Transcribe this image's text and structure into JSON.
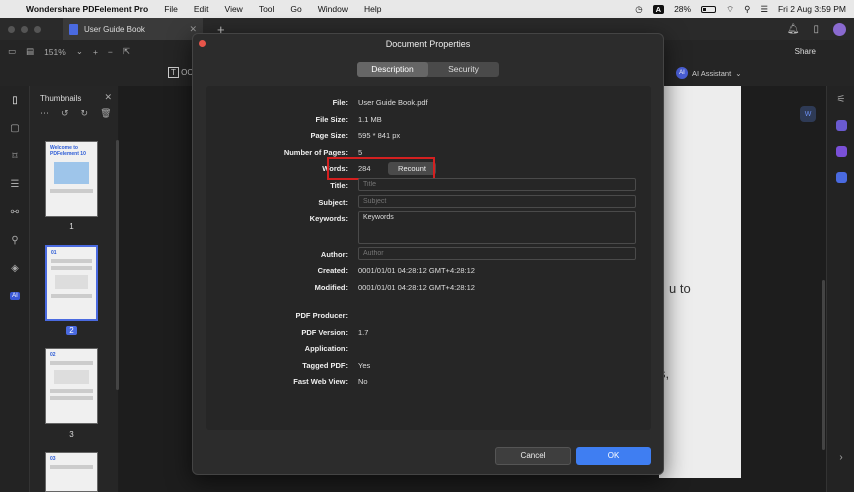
{
  "menubar": {
    "app_name": "Wondershare PDFelement Pro",
    "items": [
      "File",
      "Edit",
      "View",
      "Tool",
      "Go",
      "Window",
      "Help"
    ],
    "input_source": "A",
    "battery": "28%",
    "clock": "Fri 2 Aug  3:59 PM"
  },
  "tabbar": {
    "tab_title": "User Guide Book",
    "close_glyph": "✕",
    "new_tab_glyph": "+"
  },
  "toolbar": {
    "zoom": "151%",
    "share_label": "Share",
    "text_tool_label": "OC",
    "ai_badge": "AI",
    "ai_label": "AI Assistant"
  },
  "left_rail": {
    "ai_tag": "AI"
  },
  "thumbnails": {
    "title": "Thumbnails",
    "pages": [
      {
        "num": "1",
        "heading": "Welcome to PDFelement 10"
      },
      {
        "num": "2",
        "heading": "01"
      },
      {
        "num": "3",
        "heading": "02"
      },
      {
        "num": "",
        "heading": "03"
      }
    ]
  },
  "document": {
    "visible_text_1": "u to",
    "visible_text_2": "s,"
  },
  "dialog": {
    "title": "Document Properties",
    "tabs": {
      "description": "Description",
      "security": "Security"
    },
    "fields": {
      "file_label": "File:",
      "file_value": "User Guide Book.pdf",
      "filesize_label": "File Size:",
      "filesize_value": "1.1 MB",
      "pagesize_label": "Page Size:",
      "pagesize_value": "595 * 841 px",
      "pages_label": "Number of Pages:",
      "pages_value": "5",
      "words_label": "Words:",
      "words_value": "284",
      "recount_label": "Recount",
      "title_label": "Title:",
      "title_placeholder": "Title",
      "subject_label": "Subject:",
      "subject_placeholder": "Subject",
      "keywords_label": "Keywords:",
      "keywords_value": "Keywords",
      "author_label": "Author:",
      "author_placeholder": "Author",
      "created_label": "Created:",
      "created_value": "0001/01/01 04:28:12 GMT+4:28:12",
      "modified_label": "Modified:",
      "modified_value": "0001/01/01 04:28:12 GMT+4:28:12",
      "producer_label": "PDF Producer:",
      "producer_value": "",
      "version_label": "PDF Version:",
      "version_value": "1.7",
      "application_label": "Application:",
      "application_value": "",
      "tagged_label": "Tagged PDF:",
      "tagged_value": "Yes",
      "fastweb_label": "Fast Web View:",
      "fastweb_value": "No"
    },
    "cancel_label": "Cancel",
    "ok_label": "OK"
  }
}
